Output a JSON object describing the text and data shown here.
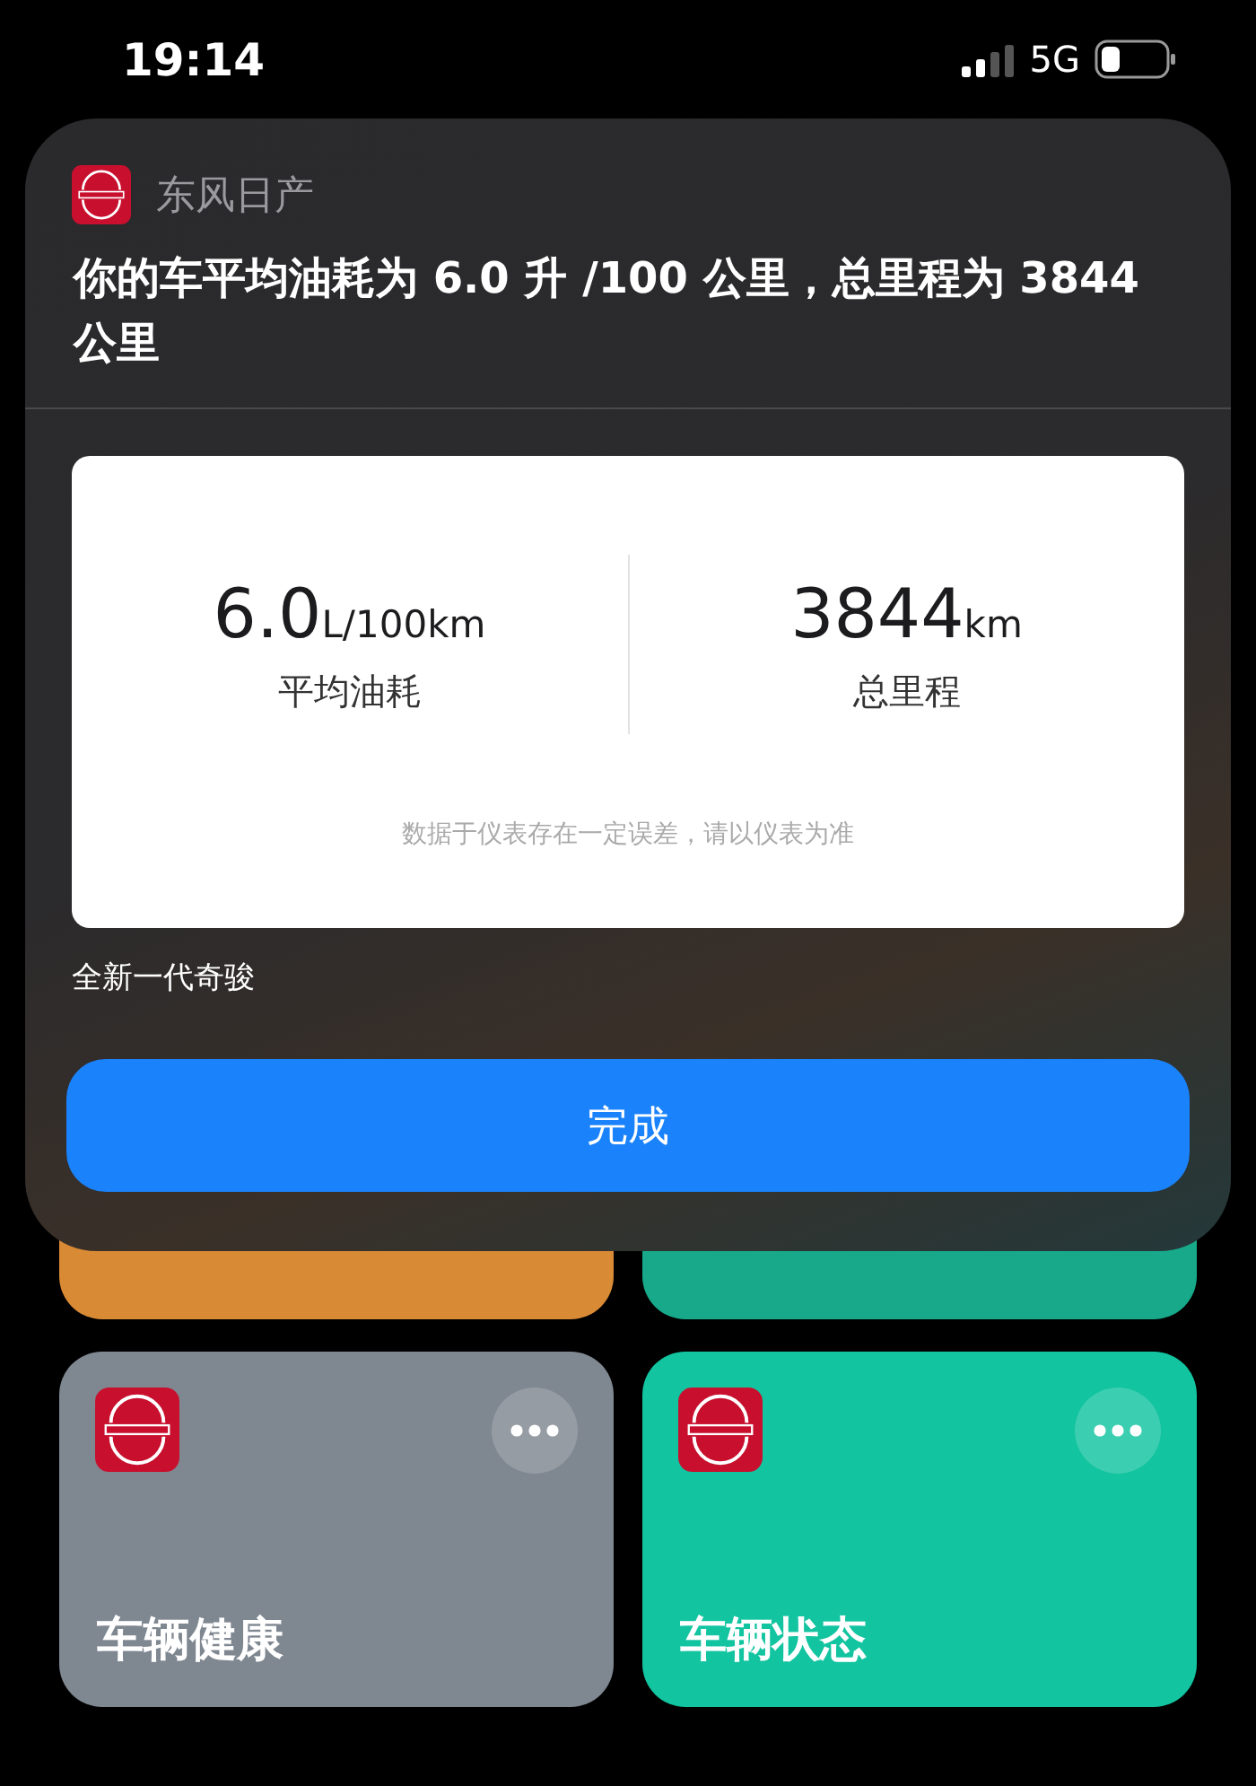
{
  "status_bar": {
    "time": "19:14",
    "network": "5G"
  },
  "sheet": {
    "app_name": "东风日产",
    "message": "你的车平均油耗为 6.0 升 /100 公里，总里程为 3844 公里",
    "stats": [
      {
        "value": "6.0",
        "unit": "L/100km",
        "label": "平均油耗"
      },
      {
        "value": "3844",
        "unit": "km",
        "label": "总里程"
      }
    ],
    "note": "数据于仪表存在一定误差，请以仪表为准",
    "vehicle": "全新一代奇骏",
    "done_button": "完成"
  },
  "covered_tiles": [
    {
      "color": "#d98a35"
    },
    {
      "color": "#17a98a"
    }
  ],
  "tiles": [
    {
      "title": "车辆健康",
      "color": "#7f8791"
    },
    {
      "title": "车辆状态",
      "color": "#12c4a0"
    }
  ]
}
